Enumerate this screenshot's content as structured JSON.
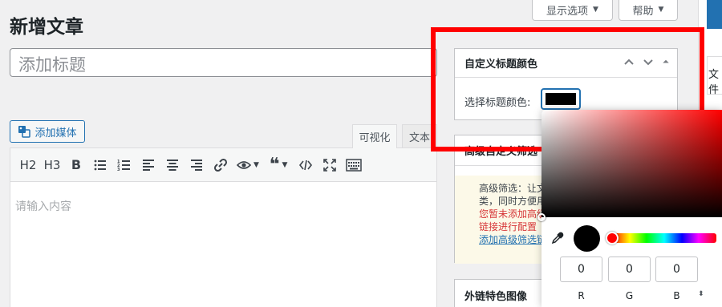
{
  "header": {
    "screen_options": "显示选项",
    "help": "帮助",
    "page_title": "新增文章"
  },
  "title_input": {
    "placeholder": "添加标题"
  },
  "editor": {
    "add_media": "添加媒体",
    "tabs": [
      "可视化",
      "文本"
    ],
    "toolbar": [
      "H2",
      "H3",
      "B"
    ],
    "content_placeholder": "请输入内容"
  },
  "title_color_box": {
    "title": "自定义标题颜色",
    "label": "选择标题颜色:",
    "selected_color": "#000000"
  },
  "filter_box": {
    "title": "高级自定义筛选",
    "notice_lines": [
      "高级筛选：让文",
      "类，同时方便用",
      "您暂未添加高级",
      "链接进行配置",
      "添加高级筛选链"
    ]
  },
  "featured_box": {
    "title": "外链特色图像"
  },
  "right_col": {
    "text": "文件"
  },
  "color_picker": {
    "r": "0",
    "g": "0",
    "b": "0",
    "labels": [
      "R",
      "G",
      "B"
    ],
    "mode_toggle": "⬍"
  },
  "colors": {
    "accent": "#2271b1",
    "highlight": "#ff0000",
    "warning": "#d63638"
  }
}
